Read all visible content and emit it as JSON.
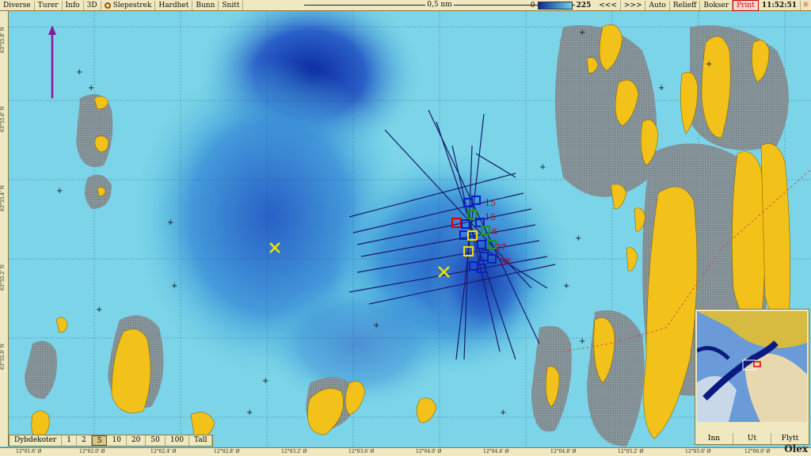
{
  "toolbar": {
    "items": [
      "Diverse",
      "Turer",
      "Info",
      "3D",
      "Slepestrek",
      "Hardhet",
      "Bunn",
      "Snitt"
    ],
    "scale_label": "0,5 nm",
    "depth_min": "0",
    "depth_max": "225",
    "nav_back": "<<<",
    "nav_forward": ">>>",
    "auto": "Auto",
    "relief": "Relieff",
    "boxes": "Bokser",
    "print": "Print",
    "clock": "11:52:51"
  },
  "left_ruler": [
    "63°55.8' N",
    "63°55.6' N",
    "63°55.4' N",
    "63°55.2' N",
    "63°55.0' N"
  ],
  "bottom_ruler": [
    "12°01.6' Ø",
    "12°02.0' Ø",
    "12°02.4' Ø",
    "12°02.8' Ø",
    "12°03.2' Ø",
    "12°03.6' Ø",
    "12°04.0' Ø",
    "12°04.4' Ø",
    "12°04.8' Ø",
    "12°05.2' Ø",
    "12°05.6' Ø",
    "12°06.0' Ø"
  ],
  "depth_contours": {
    "label": "Dybdekoter",
    "options": [
      "1",
      "2",
      "5",
      "10",
      "20",
      "50",
      "100",
      "Tall"
    ],
    "selected": "5"
  },
  "markers": {
    "labels": [
      "15",
      "15",
      "6",
      "27",
      "28"
    ]
  },
  "inset": {
    "buttons": [
      "Inn",
      "Ut",
      "Flytt"
    ]
  },
  "logo": "Olex",
  "colors": {
    "land": "#f2c21a",
    "shallow": "#7fd6e8",
    "deep": "#0a2aa0",
    "tracks": "#1a1a6a",
    "ui_bg": "#f0e8c0"
  }
}
